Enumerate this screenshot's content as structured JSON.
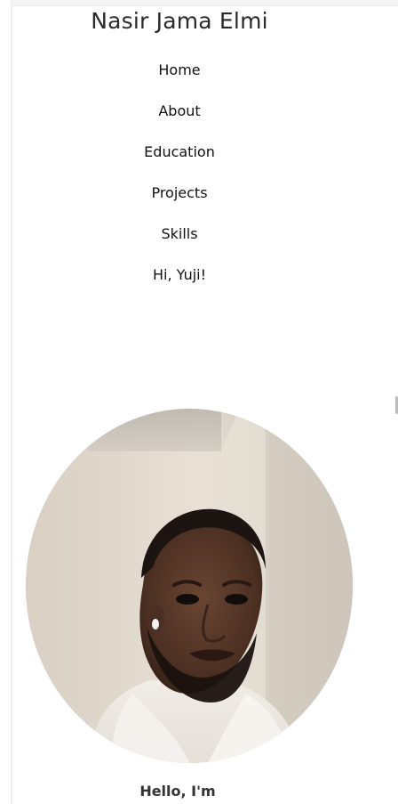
{
  "site": {
    "title": "Nasir Jama Elmi"
  },
  "nav": {
    "items": [
      {
        "label": "Home"
      },
      {
        "label": "About"
      },
      {
        "label": "Education"
      },
      {
        "label": "Projects"
      },
      {
        "label": "Skills"
      },
      {
        "label": "Hi, Yuji!"
      }
    ]
  },
  "hero": {
    "greeting": "Hello, I'm"
  },
  "colors": {
    "text": "#111111",
    "title": "#2b2b2b",
    "background": "#ffffff"
  }
}
